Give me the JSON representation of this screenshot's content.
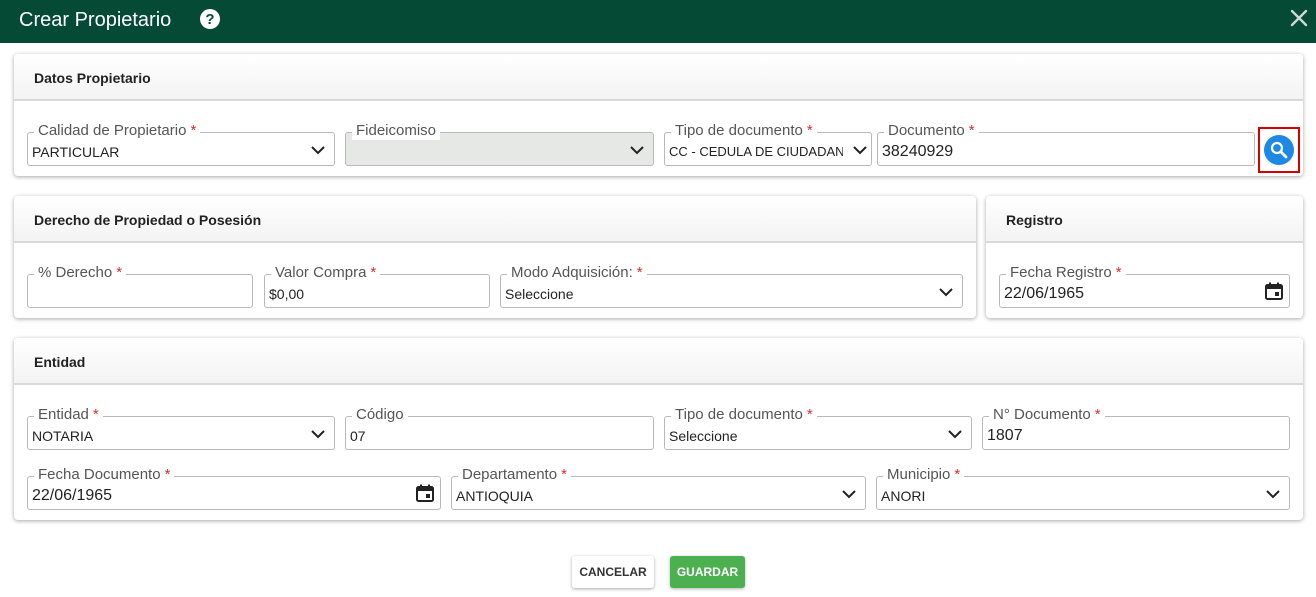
{
  "dialog": {
    "title": "Crear Propietario"
  },
  "datos_propietario": {
    "title": "Datos Propietario",
    "calidad": {
      "label": "Calidad de Propietario",
      "value": "PARTICULAR"
    },
    "fideicomiso": {
      "label": "Fideicomiso",
      "value": ""
    },
    "tipo_documento": {
      "label": "Tipo de documento",
      "value": "CC - CEDULA DE CIUDADANIA"
    },
    "documento": {
      "label": "Documento",
      "value": "38240929"
    }
  },
  "derecho": {
    "title": "Derecho de Propiedad o Posesión",
    "porcentaje": {
      "label": "% Derecho",
      "value": ""
    },
    "valor_compra": {
      "label": "Valor Compra",
      "value": "$0,00"
    },
    "modo_adquisicion": {
      "label": "Modo Adquisición:",
      "value": "Seleccione"
    }
  },
  "registro": {
    "title": "Registro",
    "fecha_registro": {
      "label": "Fecha Registro",
      "value": "22/06/1965"
    }
  },
  "entidad": {
    "title": "Entidad",
    "entidad": {
      "label": "Entidad",
      "value": "NOTARIA"
    },
    "codigo": {
      "label": "Código",
      "value": "07"
    },
    "tipo_documento": {
      "label": "Tipo de documento",
      "value": "Seleccione"
    },
    "numero_documento": {
      "label": "N° Documento",
      "value": "1807"
    },
    "fecha_documento": {
      "label": "Fecha Documento",
      "value": "22/06/1965"
    },
    "departamento": {
      "label": "Departamento",
      "value": "ANTIOQUIA"
    },
    "municipio": {
      "label": "Municipio",
      "value": "ANORI"
    }
  },
  "actions": {
    "cancel": "CANCELAR",
    "save": "GUARDAR"
  },
  "required_marker": "*",
  "icons": [
    "help-icon",
    "close-icon",
    "chevron-down-icon",
    "calendar-icon",
    "search-icon"
  ],
  "colors": {
    "header": "#044a35",
    "required": "#d32f2f",
    "save": "#4caf50",
    "search": "#1e88e5",
    "highlight": "#d40000"
  }
}
